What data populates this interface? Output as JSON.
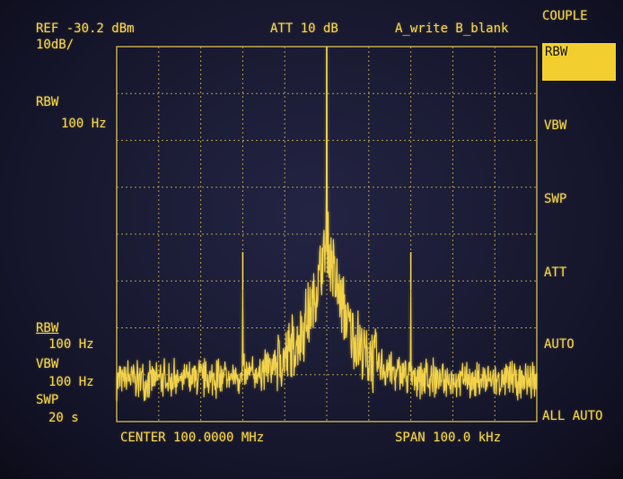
{
  "header": {
    "ref_level": "REF -30.2 dBm",
    "scale": "10dB/",
    "attenuation": "ATT 10 dB",
    "trace_mode": "A_write B_blank"
  },
  "left_panel": {
    "rbw_label": "RBW",
    "rbw_value": "100 Hz",
    "bottom": {
      "rbw_label": "RBW",
      "rbw_value": "100 Hz",
      "vbw_label": "VBW",
      "vbw_value": "100 Hz",
      "swp_label": "SWP",
      "swp_value": "20 s"
    }
  },
  "footer": {
    "center": "CENTER 100.0000 MHz",
    "span": "SPAN 100.0 kHz"
  },
  "softkeys": {
    "title": "COUPLE",
    "items": [
      "RBW",
      "VBW",
      "SWP",
      "ATT",
      "AUTO",
      "ALL AUTO"
    ],
    "active_index": 0
  },
  "colors": {
    "trace": "#f2d24a",
    "grid": "#c9b14a",
    "highlight": "#f2cf2e",
    "background": "#1c1d36"
  },
  "chart_data": {
    "type": "line",
    "xlim": [
      -50,
      50
    ],
    "ylim": [
      -130.2,
      -30.2
    ],
    "x_units_implied": "kHz offset from center",
    "y_units_implied": "dBm",
    "grid": true,
    "divisions": {
      "x": 10,
      "y": 8
    },
    "main_peak": {
      "x": 0,
      "y": -30.2
    },
    "spurs": [
      {
        "x": -20,
        "y": -95
      },
      {
        "x": 20,
        "y": -95
      }
    ],
    "noise_floor": -117
  }
}
